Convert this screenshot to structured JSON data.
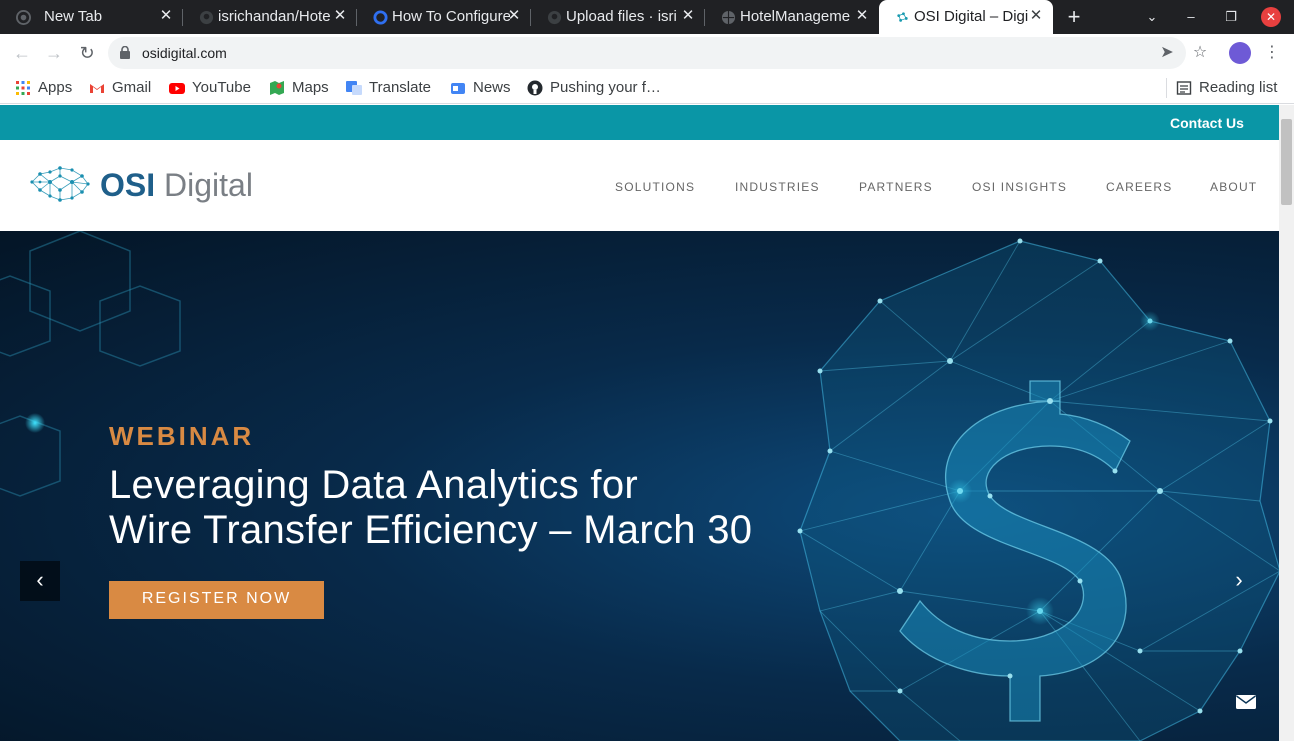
{
  "browser": {
    "tabs": [
      {
        "title": "New Tab",
        "icon": "chrome-icon"
      },
      {
        "title": "isrichandan/Hote",
        "icon": "github-icon"
      },
      {
        "title": "How To Configure",
        "icon": "digitalocean-icon"
      },
      {
        "title": "Upload files · isric",
        "icon": "github-icon"
      },
      {
        "title": "HotelManageme",
        "icon": "globe-icon"
      },
      {
        "title": "OSI Digital – Digi",
        "icon": "osi-icon",
        "active": true
      }
    ],
    "close_glyph": "✕",
    "new_tab_glyph": "+",
    "address": {
      "url": "osidigital.com"
    },
    "bookmarks": [
      {
        "label": "Apps",
        "icon": "apps-grid-icon"
      },
      {
        "label": "Gmail",
        "icon": "gmail-icon"
      },
      {
        "label": "YouTube",
        "icon": "youtube-icon"
      },
      {
        "label": "Maps",
        "icon": "maps-icon"
      },
      {
        "label": "Translate",
        "icon": "translate-icon"
      },
      {
        "label": "News",
        "icon": "news-icon"
      },
      {
        "label": "Pushing your f…",
        "icon": "github-icon"
      }
    ],
    "reading_list": "Reading list"
  },
  "site": {
    "contact": "Contact Us",
    "logo": {
      "osi": "OSI",
      "digital": "Digital"
    },
    "nav": [
      "SOLUTIONS",
      "INDUSTRIES",
      "PARTNERS",
      "OSI INSIGHTS",
      "CAREERS",
      "ABOUT"
    ],
    "hero": {
      "eyebrow": "WEBINAR",
      "headline_line1": "Leveraging Data Analytics for",
      "headline_line2": "Wire Transfer Efficiency – March 30",
      "cta": "REGISTER NOW",
      "prev": "‹",
      "next": "›"
    }
  },
  "colors": {
    "teal": "#0a96a6",
    "orange": "#d98a43",
    "navy": "#082a4a",
    "logo_blue": "#1f5f8a",
    "logo_gray": "#7a7f85"
  }
}
